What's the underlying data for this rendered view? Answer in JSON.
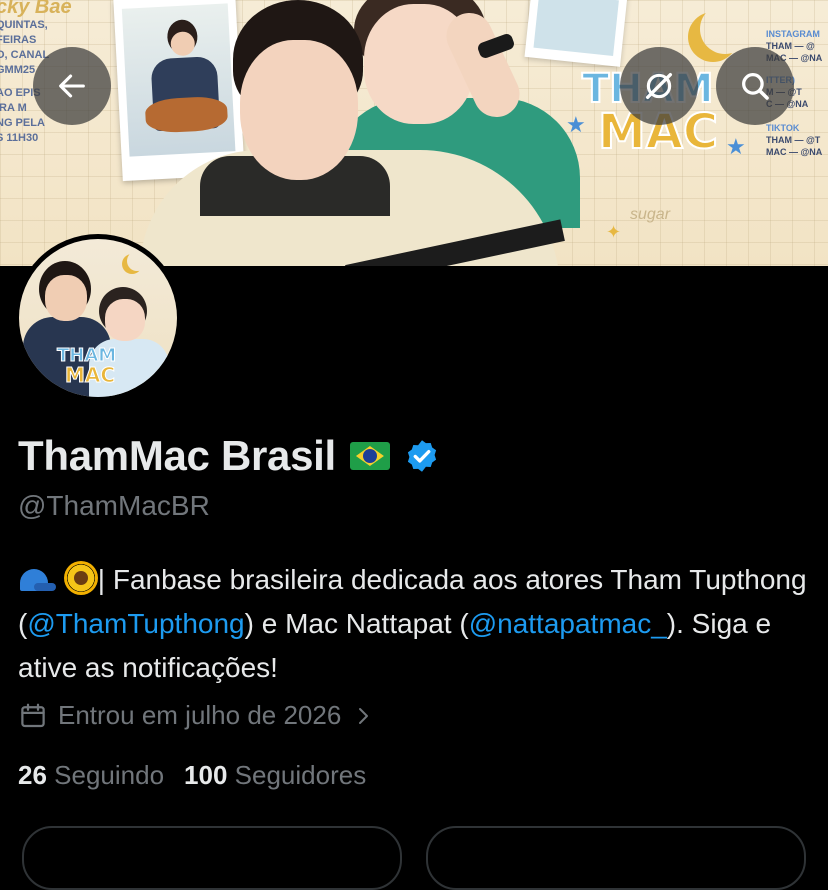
{
  "banner": {
    "left_text": [
      "cky Bae",
      "QUINTAS, FEIRAS",
      "O, CANAL GMM25",
      "AO EPIS",
      "IRA M",
      "NG PELA",
      "S 11H30"
    ],
    "right_text": {
      "instagram_heading": "INSTAGRAM",
      "instagram_lines": [
        "THAM — @",
        "MAC — @NA"
      ],
      "twitter_heading": "ITTER)",
      "twitter_lines": [
        "M — @T",
        "C — @NA"
      ],
      "tiktok_heading": "TIKTOK",
      "tiktok_lines": [
        "THAM — @T",
        "MAC — @NA"
      ]
    },
    "logo_line1": "THAM",
    "logo_line2": "MAC",
    "sticker": "sugar"
  },
  "avatar_logo": {
    "line1": "THAM",
    "line2": "MAC"
  },
  "profile": {
    "name": "ThamMac Brasil",
    "handle": "@ThamMacBR",
    "bio": {
      "segment1": "| Fanbase brasileira dedicada aos atores Tham Tupthong (",
      "mention1": "@ThamTupthong",
      "segment2": ") e Mac Nattapat (",
      "mention2": "@nattapatmac_",
      "segment3": "). Siga e ative as notificações!"
    },
    "joined": "Entrou em julho de 2026",
    "following_count": "26",
    "following_label": "Seguindo",
    "followers_count": "100",
    "followers_label": "Seguidores"
  },
  "colors": {
    "background": "#000000",
    "text_primary": "#e7e9ea",
    "text_secondary": "#71767b",
    "link": "#1d9bf0",
    "verified": "#1d9bf0"
  },
  "icons": {
    "back": "arrow-left-icon",
    "grok": "grok-icon",
    "search": "search-icon",
    "verified": "verified-badge-icon",
    "calendar": "calendar-icon",
    "chevron": "chevron-right-icon"
  }
}
